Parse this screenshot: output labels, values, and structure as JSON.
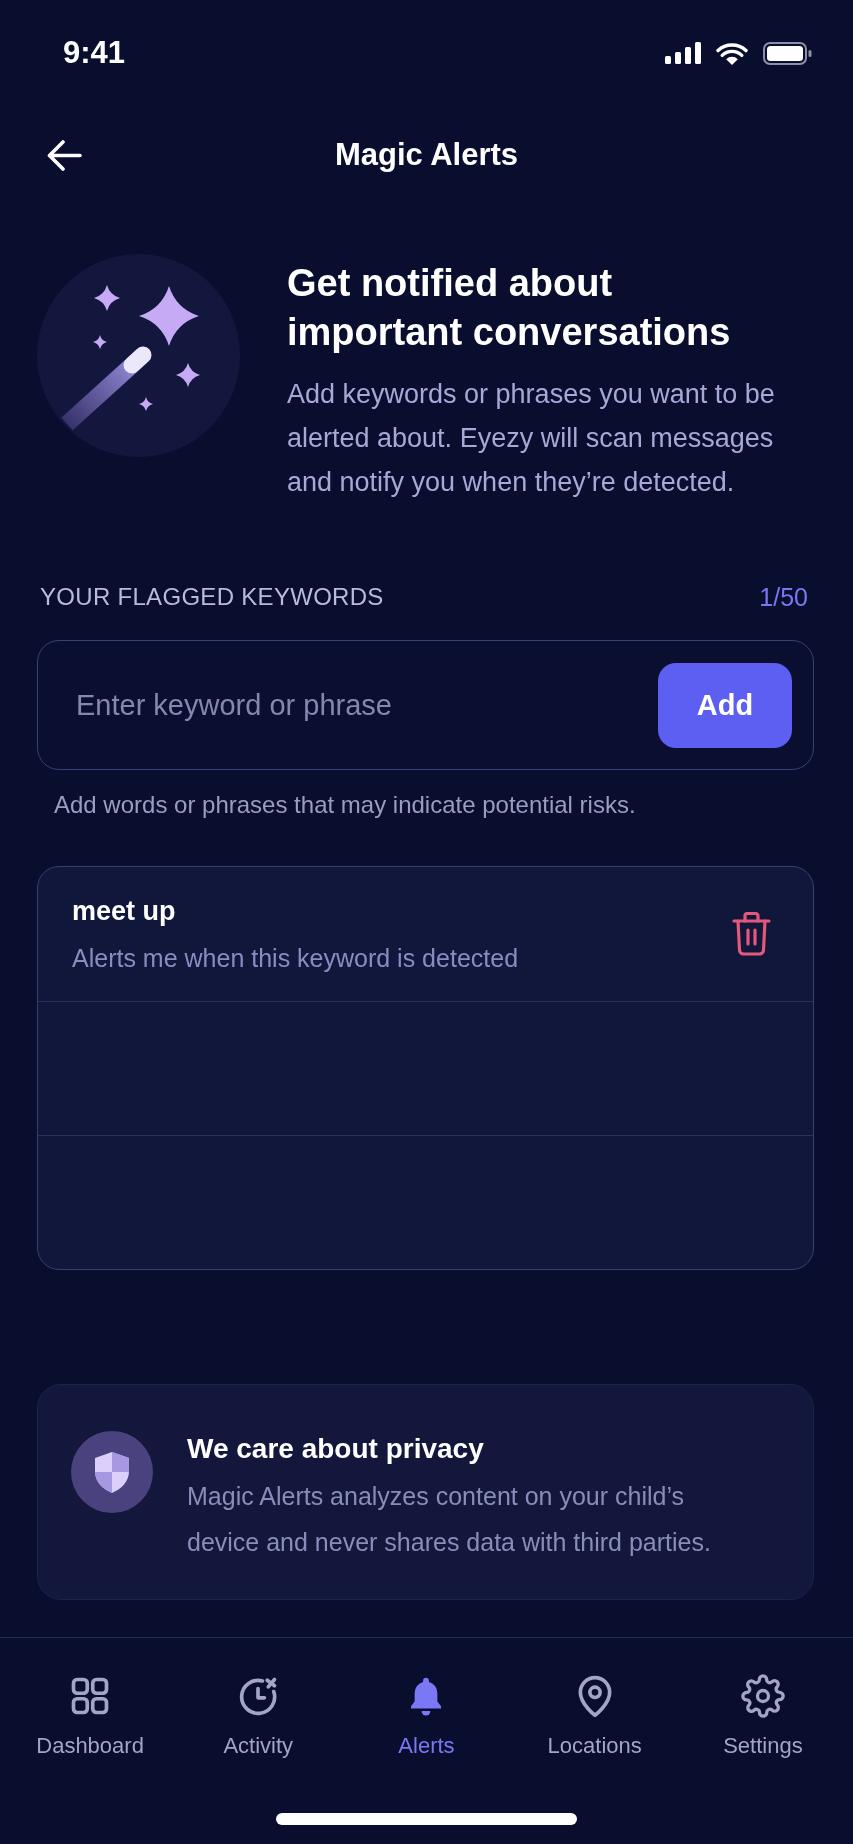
{
  "status_bar": {
    "time": "9:41"
  },
  "header": {
    "title": "Magic Alerts"
  },
  "intro": {
    "heading": "Get notified about important conversations",
    "description": "Add keywords or phrases you want to be alerted about. Eyezy will scan messages and notify you when they’re detected."
  },
  "keywords": {
    "label": "YOUR FLAGGED KEYWORDS",
    "count": "1/50",
    "input": {
      "placeholder": "Enter keyword or phrase"
    },
    "add_button": "Add",
    "hint": "Add words or phrases that may indicate potential risks.",
    "items": [
      {
        "kind": "keyword",
        "keyword": "meet up",
        "description": "Alerts me when this keyword is detected"
      },
      {
        "kind": "empty"
      },
      {
        "kind": "empty"
      }
    ]
  },
  "privacy_card": {
    "title": "We care about privacy",
    "text": "Magic Alerts analyzes content on your child’s device and never shares data with third parties."
  },
  "nav": {
    "items": [
      {
        "label": "Dashboard",
        "selected": false
      },
      {
        "label": "Activity",
        "selected": false
      },
      {
        "label": "Alerts",
        "selected": true
      },
      {
        "label": "Locations",
        "selected": false
      },
      {
        "label": "Settings",
        "selected": false
      }
    ]
  }
}
